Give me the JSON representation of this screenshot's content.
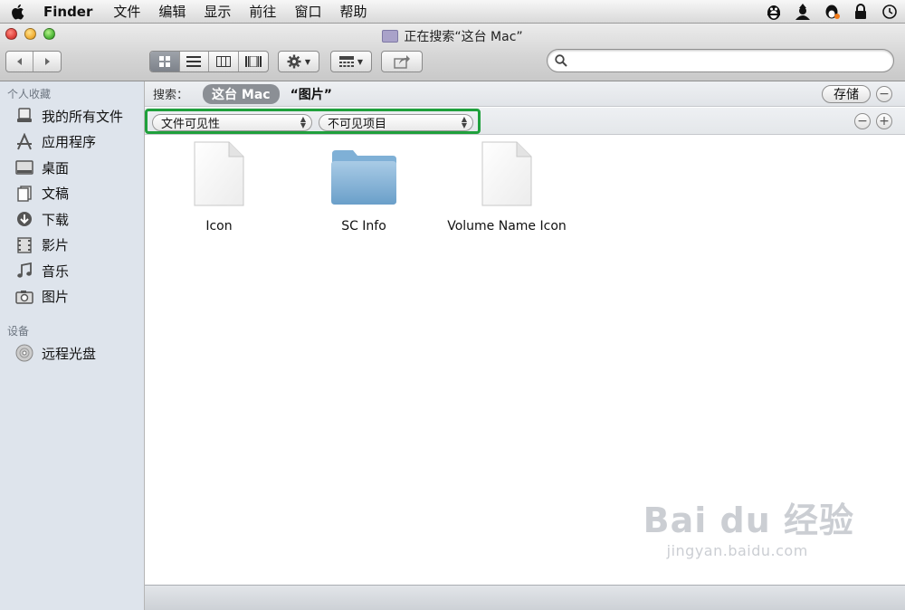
{
  "menubar": {
    "app_name": "Finder",
    "items": [
      "文件",
      "编辑",
      "显示",
      "前往",
      "窗口",
      "帮助"
    ],
    "tray_icons": [
      "qq-penguin-icon",
      "user-hat-icon",
      "qq-bell-icon",
      "lock-icon",
      "time-machine-icon"
    ]
  },
  "window": {
    "title": "正在搜索“这台 Mac”",
    "search_placeholder": ""
  },
  "toolbar": {
    "view_modes": [
      "icon-view-icon",
      "list-view-icon",
      "column-view-icon",
      "coverflow-view-icon"
    ],
    "active_view": "icon-view-icon",
    "action_icon": "gear-icon",
    "arrange_icon": "arrange-icon",
    "share_icon": "share-icon"
  },
  "sidebar": {
    "favorites_header": "个人收藏",
    "favorites": [
      {
        "label": "我的所有文件",
        "icon": "all-files-icon"
      },
      {
        "label": "应用程序",
        "icon": "applications-icon"
      },
      {
        "label": "桌面",
        "icon": "desktop-icon"
      },
      {
        "label": "文稿",
        "icon": "documents-icon"
      },
      {
        "label": "下载",
        "icon": "downloads-icon"
      },
      {
        "label": "影片",
        "icon": "movies-icon"
      },
      {
        "label": "音乐",
        "icon": "music-icon"
      },
      {
        "label": "图片",
        "icon": "pictures-icon"
      }
    ],
    "devices_header": "设备",
    "devices": [
      {
        "label": "远程光盘",
        "icon": "remote-disc-icon"
      }
    ]
  },
  "scope": {
    "label": "搜索：",
    "this_mac": "这台 Mac",
    "quoted": "“图片”",
    "save": "存储",
    "remove_symbol": "−",
    "add_symbol": "+"
  },
  "criteria": {
    "attribute": "文件可见性",
    "value": "不可见项目",
    "highlight_color": "#1fa03c"
  },
  "files": [
    {
      "name": "Icon",
      "icon": "document-icon"
    },
    {
      "name": "SC Info",
      "icon": "folder-icon"
    },
    {
      "name": "Volume Name Icon",
      "icon": "document-icon"
    }
  ],
  "watermark": {
    "brand": "Bai du 经验",
    "url": "jingyan.baidu.com"
  }
}
